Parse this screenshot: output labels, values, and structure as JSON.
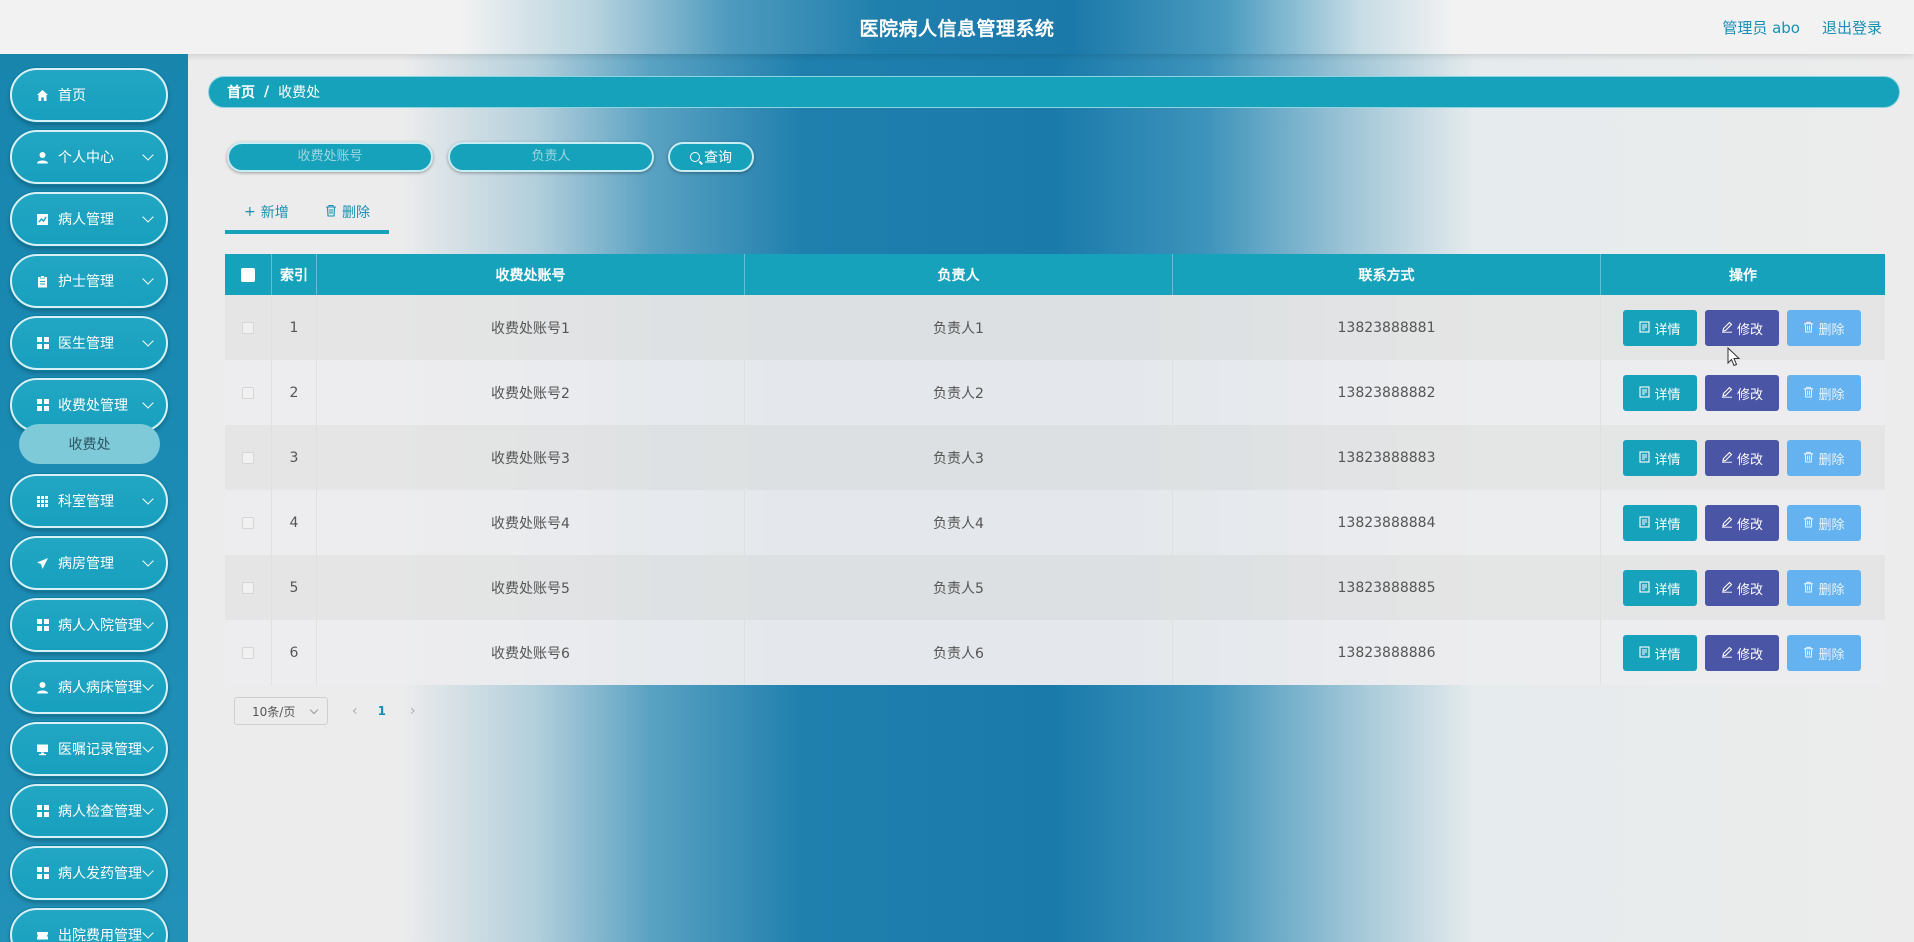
{
  "header": {
    "title": "医院病人信息管理系统",
    "admin_label": "管理员 abo",
    "logout_label": "退出登录"
  },
  "sidebar": {
    "items": [
      {
        "label": "首页",
        "icon": "home-icon"
      },
      {
        "label": "个人中心",
        "icon": "user-icon"
      },
      {
        "label": "病人管理",
        "icon": "chart-icon"
      },
      {
        "label": "护士管理",
        "icon": "clipboard-icon"
      },
      {
        "label": "医生管理",
        "icon": "grid-icon"
      },
      {
        "label": "收费处管理",
        "icon": "grid-icon"
      },
      {
        "label": "科室管理",
        "icon": "grid-icon"
      },
      {
        "label": "病房管理",
        "icon": "send-icon"
      },
      {
        "label": "病人入院管理",
        "icon": "grid-icon"
      },
      {
        "label": "病人病床管理",
        "icon": "user-icon"
      },
      {
        "label": "医嘱记录管理",
        "icon": "monitor-icon"
      },
      {
        "label": "病人检查管理",
        "icon": "grid-icon"
      },
      {
        "label": "病人发药管理",
        "icon": "grid-icon"
      },
      {
        "label": "出院费用管理",
        "icon": "ticket-icon"
      }
    ],
    "sub_item": "收费处"
  },
  "breadcrumb": {
    "home": "首页",
    "separator": "/",
    "current": "收费处"
  },
  "search": {
    "account_placeholder": "收费处账号",
    "person_placeholder": "负责人",
    "query_label": "查询"
  },
  "actions": {
    "add_label": "新增",
    "delete_label": "删除"
  },
  "table": {
    "columns": [
      "索引",
      "收费处账号",
      "负责人",
      "联系方式",
      "操作"
    ],
    "rows": [
      {
        "index": "1",
        "account": "收费处账号1",
        "person": "负责人1",
        "phone": "13823888881"
      },
      {
        "index": "2",
        "account": "收费处账号2",
        "person": "负责人2",
        "phone": "13823888882"
      },
      {
        "index": "3",
        "account": "收费处账号3",
        "person": "负责人3",
        "phone": "13823888883"
      },
      {
        "index": "4",
        "account": "收费处账号4",
        "person": "负责人4",
        "phone": "13823888884"
      },
      {
        "index": "5",
        "account": "收费处账号5",
        "person": "负责人5",
        "phone": "13823888885"
      },
      {
        "index": "6",
        "account": "收费处账号6",
        "person": "负责人6",
        "phone": "13823888886"
      }
    ],
    "row_buttons": {
      "detail": "详情",
      "edit": "修改",
      "delete": "删除"
    }
  },
  "pagination": {
    "page_size": "10条/页",
    "current_page": "1"
  },
  "colors": {
    "accent": "#17a2bb",
    "edit": "#4a55a6",
    "delete": "#64b3f0",
    "link": "#1a8fb3"
  }
}
